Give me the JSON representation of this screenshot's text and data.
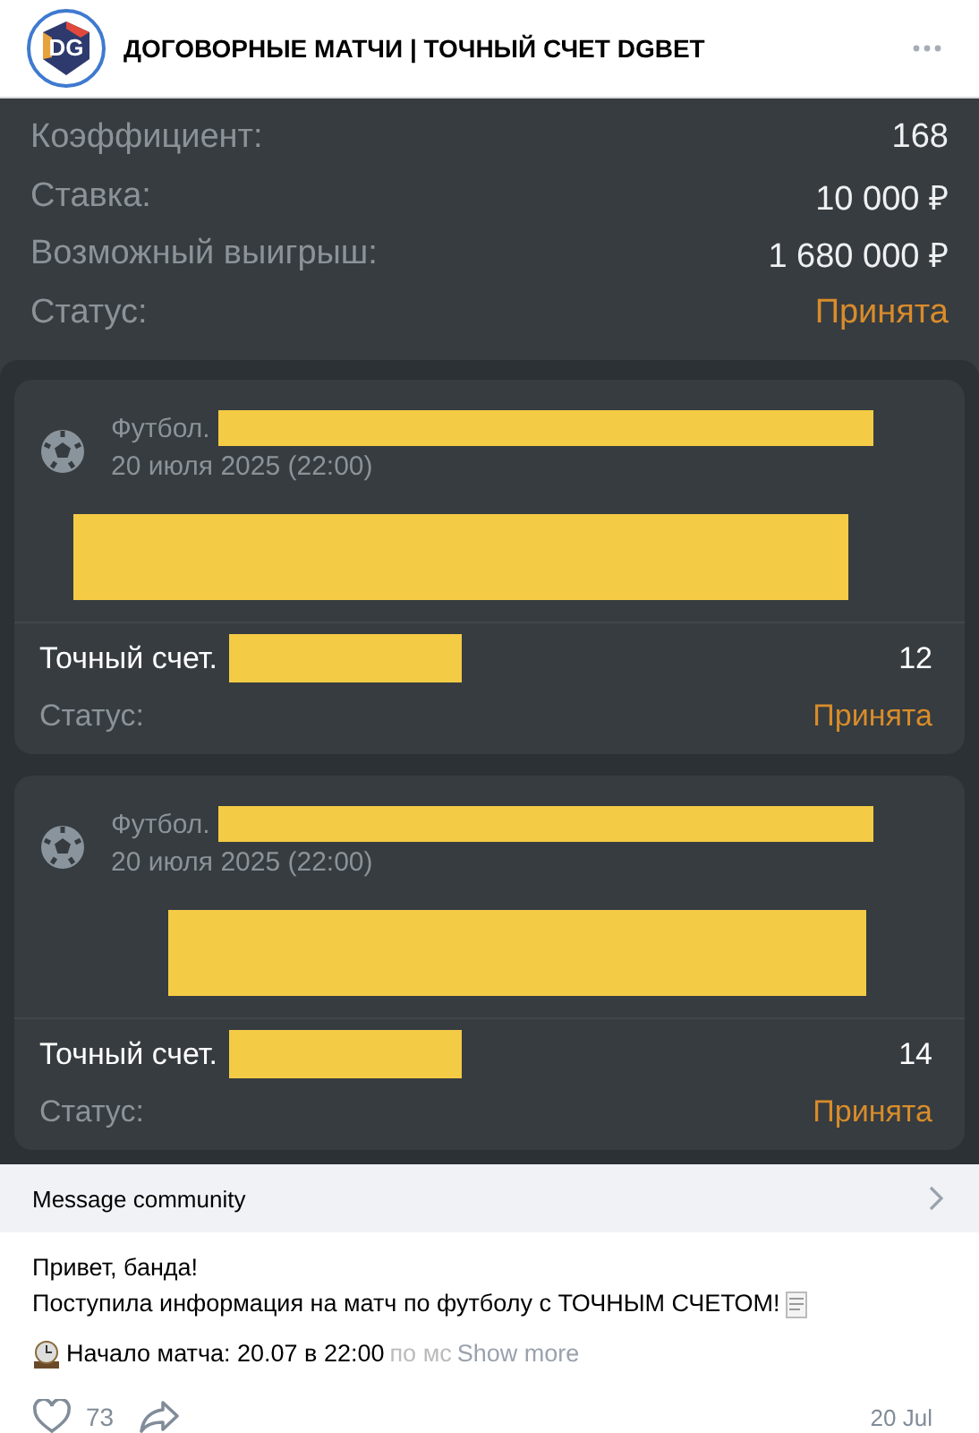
{
  "header": {
    "avatar_text": "DG",
    "title": "ДОГОВОРНЫЕ МАТЧИ | ТОЧНЫЙ СЧЕТ DGBET"
  },
  "bet_summary": [
    {
      "label": "Коэффициент:",
      "value": "168",
      "kind": "plain"
    },
    {
      "label": "Ставка:",
      "value": "10 000 ₽",
      "kind": "plain"
    },
    {
      "label": "Возможный выигрыш:",
      "value": "1 680 000 ₽",
      "kind": "plain"
    },
    {
      "label": "Статус:",
      "value": "Принята",
      "kind": "status"
    }
  ],
  "bets": [
    {
      "sport": "Футбол.",
      "date": "20 июля 2025 (22:00)",
      "market": "Точный счет.",
      "odds": "12",
      "status_label": "Статус:",
      "status": "Принята"
    },
    {
      "sport": "Футбол.",
      "date": "20 июля 2025 (22:00)",
      "market": "Точный счет.",
      "odds": "14",
      "status_label": "Статус:",
      "status": "Принята"
    }
  ],
  "message_bar": {
    "label": "Message community"
  },
  "post": {
    "lines": [
      "Привет, банда!",
      "Поступила информация на матч по футболу с ТОЧНЫМ СЧЕТОМ!"
    ],
    "start_line": "Начало матча: 20.07 в 22:00",
    "faded_tail": "по мс",
    "show_more": "Show more"
  },
  "footer": {
    "likes": "73",
    "date": "20 Jul"
  }
}
